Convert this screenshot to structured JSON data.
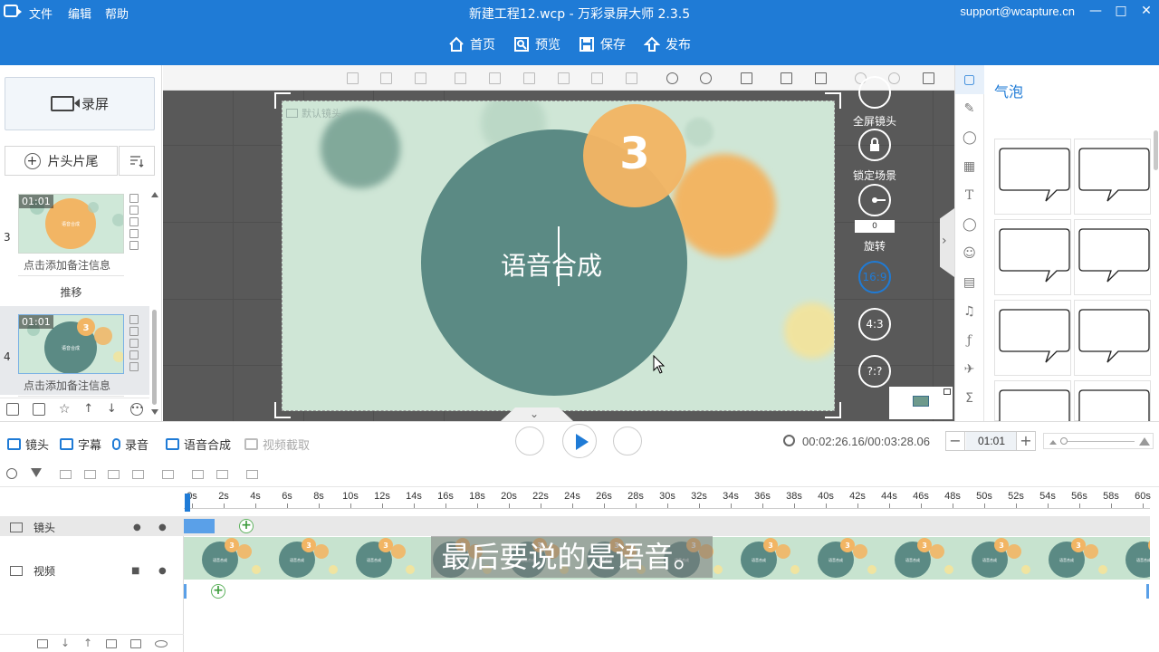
{
  "window": {
    "title": "新建工程12.wcp - 万彩录屏大师 2.3.5",
    "email": "support@wcapture.cn",
    "menu": [
      "文件",
      "编辑",
      "帮助"
    ]
  },
  "nav": {
    "home": "首页",
    "preview": "预览",
    "save": "保存",
    "publish": "发布"
  },
  "left_panel": {
    "record_label": "录屏",
    "headtail_label": "片头片尾",
    "scenes": [
      {
        "num": "3",
        "time": "01:01",
        "note": "点击添加备注信息",
        "transition": "推移"
      },
      {
        "num": "4",
        "time": "01:01",
        "note": "点击添加备注信息"
      }
    ]
  },
  "canvas": {
    "camera_label": "默认镜头",
    "number": "3",
    "title": "语音合成"
  },
  "side_controls": {
    "fullscreen": "全屏镜头",
    "lock": "锁定场景",
    "rotate": "旋转",
    "rotate_value": "0",
    "ratio_169": "16:9",
    "ratio_43": "4:3",
    "ratio_custom": "?:?"
  },
  "right_panel": {
    "title": "气泡"
  },
  "timeline": {
    "tools": {
      "lens": "镜头",
      "subtitle": "字幕",
      "record": "录音",
      "tts": "语音合成",
      "capture": "视频截取"
    },
    "time": "00:02:26.16/00:03:28.06",
    "zoom": "01:01",
    "ruler": [
      "0s",
      "2s",
      "4s",
      "6s",
      "8s",
      "10s",
      "12s",
      "14s",
      "16s",
      "18s",
      "20s",
      "22s",
      "24s",
      "26s",
      "28s",
      "30s",
      "32s",
      "34s",
      "36s",
      "38s",
      "40s",
      "42s",
      "44s",
      "46s",
      "48s",
      "50s",
      "52s",
      "54s",
      "56s",
      "58s",
      "60s"
    ],
    "tracks": {
      "lens": "镜头",
      "video": "视频"
    },
    "subtitle_text": "最后要说的是语音。"
  },
  "colors": {
    "brand": "#1f7bd6",
    "teal": "#5b8a84",
    "orange": "#f2b564",
    "mint": "#cfe6d6"
  }
}
